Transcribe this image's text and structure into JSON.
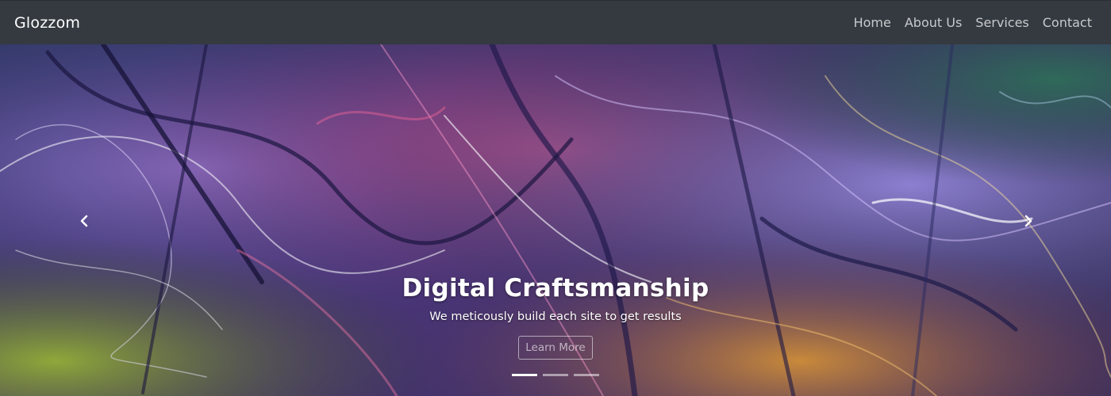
{
  "navbar": {
    "brand": "Glozzom",
    "links": [
      {
        "label": "Home"
      },
      {
        "label": "About Us"
      },
      {
        "label": "Services"
      },
      {
        "label": "Contact"
      }
    ]
  },
  "carousel": {
    "title": "Digital Craftsmanship",
    "text": "We meticously build each site to get results",
    "button_label": "Learn More",
    "prev_icon": "chevron-left-icon",
    "next_icon": "chevron-right-icon",
    "slide_count": 3,
    "active_slide": 1
  },
  "colors": {
    "navbar_bg": "#343a40",
    "brand": "#ffffff",
    "nav_link": "#c8cacd"
  }
}
